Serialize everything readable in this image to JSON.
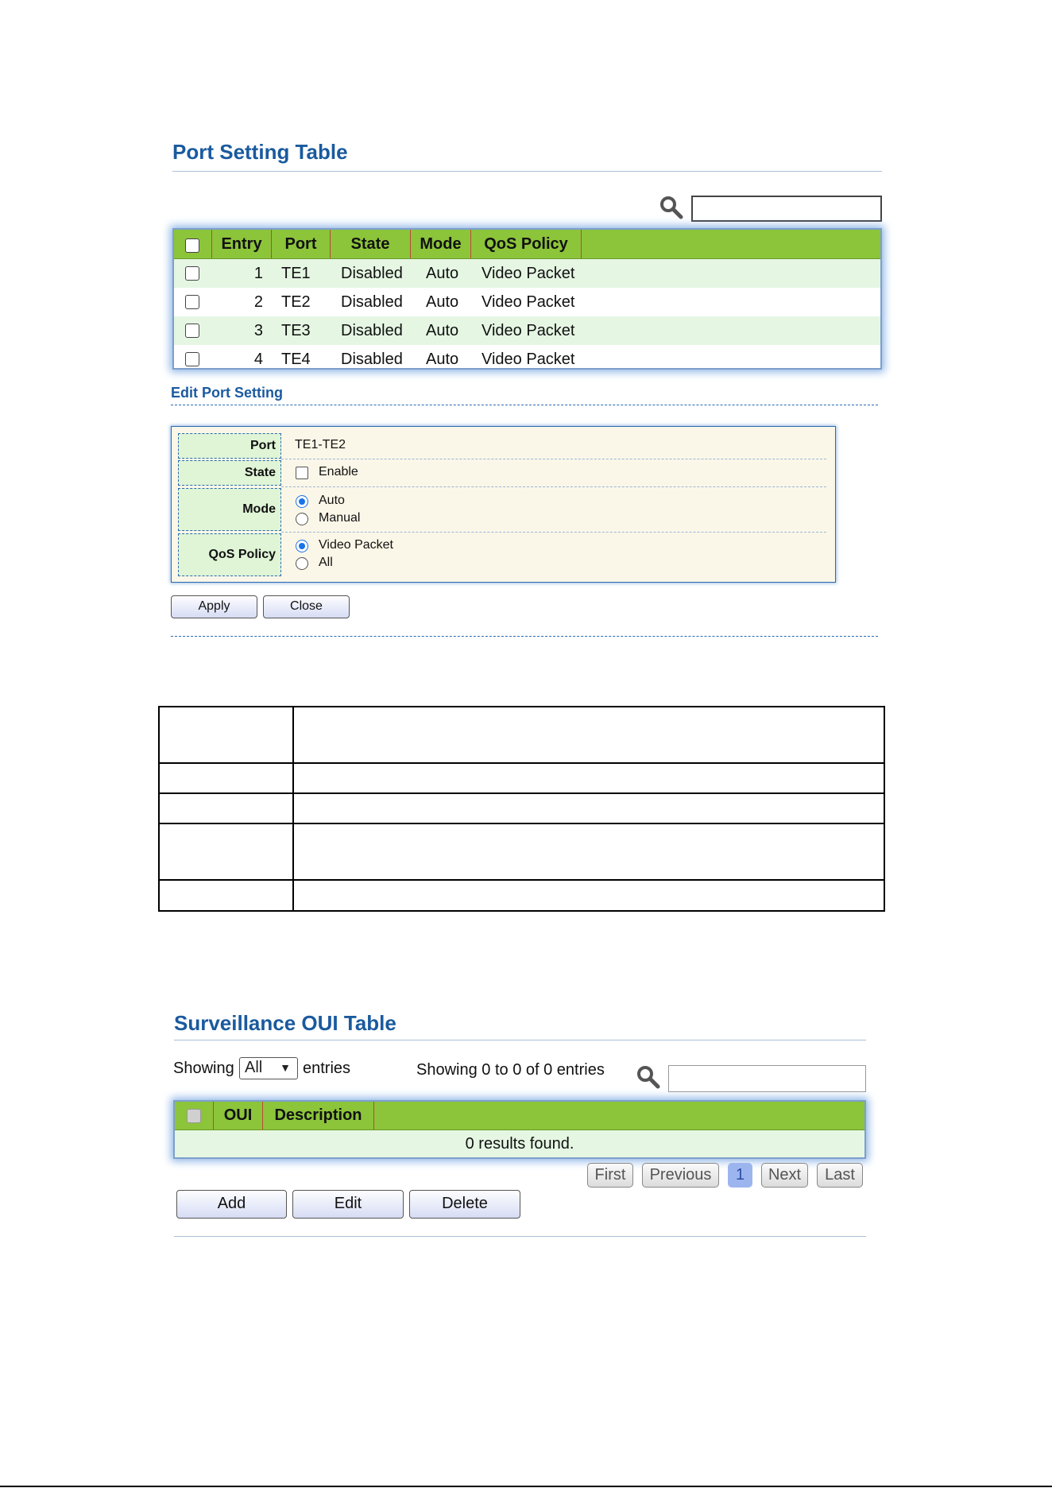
{
  "port_setting": {
    "title": "Port Setting Table",
    "columns": [
      "Entry",
      "Port",
      "State",
      "Mode",
      "QoS Policy"
    ],
    "rows": [
      {
        "entry": "1",
        "port": "TE1",
        "state": "Disabled",
        "mode": "Auto",
        "qos": "Video Packet"
      },
      {
        "entry": "2",
        "port": "TE2",
        "state": "Disabled",
        "mode": "Auto",
        "qos": "Video Packet"
      },
      {
        "entry": "3",
        "port": "TE3",
        "state": "Disabled",
        "mode": "Auto",
        "qos": "Video Packet"
      },
      {
        "entry": "4",
        "port": "TE4",
        "state": "Disabled",
        "mode": "Auto",
        "qos": "Video Packet"
      }
    ]
  },
  "edit": {
    "title": "Edit Port Setting",
    "port_label": "Port",
    "port_value": "TE1-TE2",
    "state_label": "State",
    "state_option": "Enable",
    "mode_label": "Mode",
    "mode_options": [
      "Auto",
      "Manual"
    ],
    "mode_selected": "Auto",
    "qos_label": "QoS Policy",
    "qos_options": [
      "Video Packet",
      "All"
    ],
    "qos_selected": "Video Packet",
    "apply_label": "Apply",
    "close_label": "Close"
  },
  "oui": {
    "title": "Surveillance OUI Table",
    "showing_label": "Showing",
    "showing_select": "All",
    "entries_label": "entries",
    "summary": "Showing 0 to 0 of 0 entries",
    "columns": [
      "OUI",
      "Description"
    ],
    "empty_text": "0 results found.",
    "pagination": {
      "first": "First",
      "previous": "Previous",
      "current": "1",
      "next": "Next",
      "last": "Last"
    },
    "add_label": "Add",
    "edit_label": "Edit",
    "delete_label": "Delete"
  },
  "colors": {
    "title_blue": "#1a5a9e",
    "header_green": "#8cc43a",
    "row_alt_green": "#e5f7e3",
    "form_bg": "#fbf7e8",
    "label_bg": "#dff5d6"
  }
}
